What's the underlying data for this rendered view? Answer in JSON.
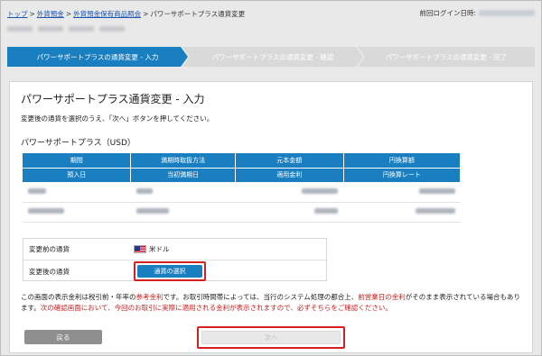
{
  "breadcrumb": {
    "items": [
      "トップ",
      "外貨預金",
      "外貨預金保有商品照会"
    ],
    "separator": ">",
    "current": "パワーサポートプラス通貨変更"
  },
  "header": {
    "last_login_label": "前回ログイン日時:"
  },
  "steps": [
    {
      "label": "パワーサポートプラスの通貨変更 - 入力",
      "active": true
    },
    {
      "label": "パワーサポートプラスの通貨変更 - 確認",
      "active": false
    },
    {
      "label": "パワーサポートプラスの通貨変更 - 完了",
      "active": false
    }
  ],
  "main": {
    "title": "パワーサポートプラス通貨変更 - 入力",
    "instruction": "変更後の通貨を選択のうえ、「次へ」ボタンを押してください。",
    "product_title": "パワーサポートプラス（USD）"
  },
  "table": {
    "header_row1": [
      "期間",
      "満期時取扱方法",
      "元本金額",
      "円換算額"
    ],
    "header_row2": [
      "預入日",
      "当初満期日",
      "適用金利",
      "円換算レート"
    ]
  },
  "currency": {
    "before_label": "変更前の通貨",
    "before_value": "米ドル",
    "after_label": "変更後の通貨",
    "select_button": "通貨の選択"
  },
  "notice": {
    "part1": "この画面の表示金利は税引前・年率の",
    "part2_red": "参考金利",
    "part3": "です。お取引時間帯によっては、当行のシステム処理の都合上、",
    "part4_red": "前営業日の金利",
    "part5": "がそのまま表示されている場合もあります。",
    "part6_red": "次の確認画面において、今回のお取引に実際に適用される金利が表示されますので、必ずそちらをご確認ください。"
  },
  "buttons": {
    "back": "戻る",
    "next": "次へ"
  },
  "colors": {
    "primary": "#1a7fc1",
    "highlight": "#d61f1f",
    "link": "#1a55b0"
  }
}
